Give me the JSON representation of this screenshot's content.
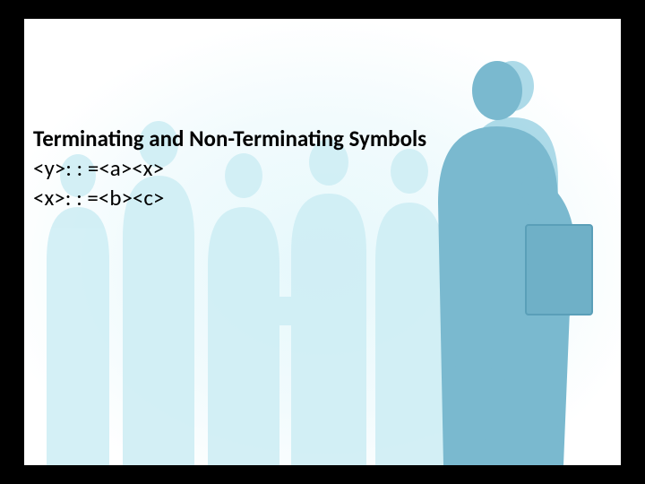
{
  "slide": {
    "title": "Terminating and Non-Terminating Symbols",
    "rule1": "<y>: : =<a><x>",
    "rule2": "<x>: : =<b><c>"
  }
}
